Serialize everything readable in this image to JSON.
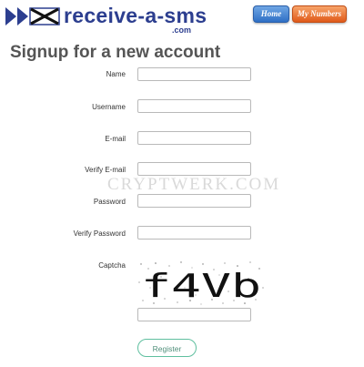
{
  "header": {
    "logo_text": "receive-a-sms",
    "logo_sub": ".com",
    "nav": {
      "home_label": "Home",
      "my_numbers_label": "My Numbers"
    }
  },
  "main": {
    "title": "Signup for a new account",
    "fields": {
      "name_label": "Name",
      "username_label": "Username",
      "email_label": "E-mail",
      "verify_email_label": "Verify E-mail",
      "password_label": "Password",
      "verify_password_label": "Verify Password",
      "captcha_label": "Captcha"
    },
    "captcha_text": "f4Vb",
    "register_label": "Register"
  },
  "watermark": "CRYPTWERK.COM",
  "colors": {
    "logo_blue": "#2c3e8f",
    "home_button": "#3f7fd0",
    "my_numbers_button": "#ea6a2a",
    "register_border": "#5fbf9f"
  }
}
